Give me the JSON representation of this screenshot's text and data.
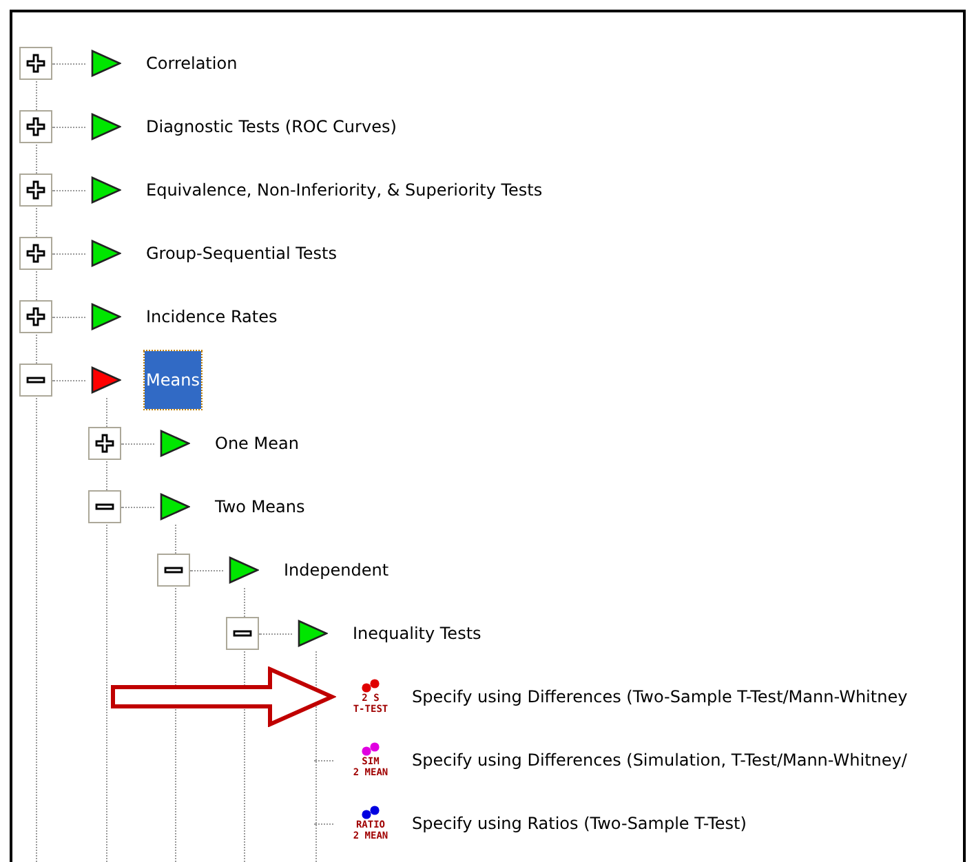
{
  "tree": [
    {
      "label": "Correlation",
      "expanded": false,
      "selected": false
    },
    {
      "label": "Diagnostic Tests (ROC Curves)",
      "expanded": false,
      "selected": false
    },
    {
      "label": "Equivalence, Non-Inferiority, & Superiority Tests",
      "expanded": false,
      "selected": false
    },
    {
      "label": "Group-Sequential Tests",
      "expanded": false,
      "selected": false
    },
    {
      "label": "Incidence Rates",
      "expanded": false,
      "selected": false
    },
    {
      "label": "Means",
      "expanded": true,
      "selected": true,
      "children": [
        {
          "label": "One Mean",
          "expanded": false,
          "selected": false
        },
        {
          "label": "Two Means",
          "expanded": true,
          "selected": false,
          "children": [
            {
              "label": "Independent",
              "expanded": true,
              "selected": false,
              "children": [
                {
                  "label": "Inequality Tests",
                  "expanded": true,
                  "selected": false,
                  "children": [
                    {
                      "kind": "procedure",
                      "label": "Specify using Differences (Two-Sample T-Test/Mann-Whitney",
                      "icon_lines": [
                        "2 S",
                        "T-TEST"
                      ],
                      "color": "#e00000"
                    },
                    {
                      "kind": "procedure",
                      "label": "Specify using Differences (Simulation, T-Test/Mann-Whitney/",
                      "icon_lines": [
                        "SIM",
                        "2 MEAN"
                      ],
                      "color": "#e000e0"
                    },
                    {
                      "kind": "procedure",
                      "label": "Specify using Ratios (Two-Sample T-Test)",
                      "icon_lines": [
                        "RATIO",
                        "2 MEAN"
                      ],
                      "color": "#0000e0"
                    }
                  ]
                }
              ]
            }
          ]
        }
      ]
    }
  ]
}
